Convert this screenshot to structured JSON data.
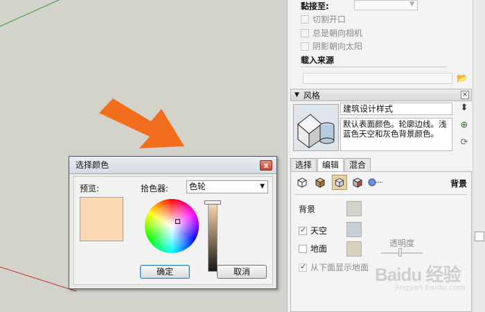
{
  "tray": {
    "glue_label": "黏接至:",
    "cut_opening": "切割开口",
    "always_face_camera": "总是朝向相机",
    "shadow_face_sun": "阴影朝向太阳",
    "load_source": "载入来源"
  },
  "styles_panel": {
    "title": "风格",
    "style_name": "建筑设计样式",
    "description": "默认表面颜色。轮廓边线。浅蓝色天空和灰色背景颜色。",
    "tabs": [
      {
        "label": "选择",
        "active": false
      },
      {
        "label": "编辑",
        "active": true
      },
      {
        "label": "混合",
        "active": false
      }
    ],
    "section_label": "背景",
    "background_label": "背景",
    "sky_label": "天空",
    "sky_checked": true,
    "ground_label": "地面",
    "ground_checked": false,
    "transparency_label": "透明度",
    "show_ground_below_label": "从下面显示地面",
    "show_ground_below_checked": true,
    "colors": {
      "background": "#d3d3cc",
      "sky": "#c8d0d6",
      "ground": "#d6d3bb"
    }
  },
  "dialog": {
    "title": "选择颜色",
    "preview_label": "预览:",
    "picker_label": "拾色器:",
    "picker_value": "色轮",
    "ok_label": "确定",
    "cancel_label": "取消",
    "preview_color": "#fcd8b0"
  },
  "watermark": {
    "text": "Baidu 经验",
    "url": "jingyan.baidu.com"
  }
}
